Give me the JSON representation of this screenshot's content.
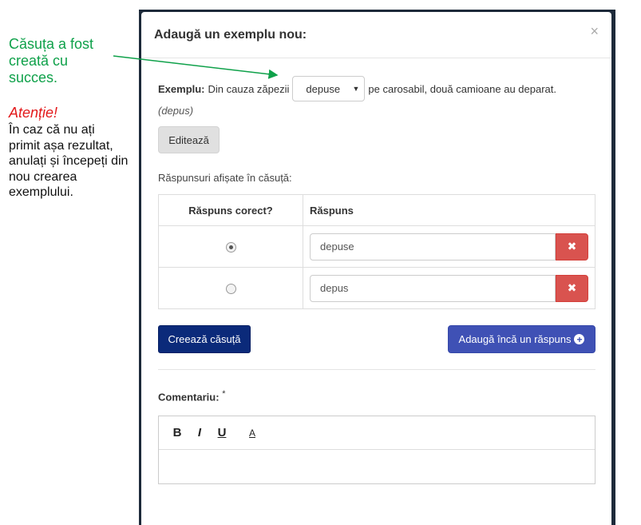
{
  "annotation": {
    "success": "Căsuța a fost creată cu succes.",
    "warning_title": "Atenție!",
    "warning_body": "În caz că nu ați primit așa rezultat, anulați și începeți din nou crearea exemplului."
  },
  "modal": {
    "title": "Adaugă un exemplu nou:",
    "close": "×",
    "example": {
      "label": "Exemplu:",
      "before": "Din cauza zăpezii",
      "dropdown_value": "depuse",
      "after": "pe carosabil, două camioane au deparat.",
      "hint": "(depus)"
    },
    "edit_button": "Editează",
    "answers_label": "Răspunsuri afișate în căsuță:",
    "table": {
      "col_correct": "Răspuns corect?",
      "col_answer": "Răspuns",
      "rows": [
        {
          "value": "depuse",
          "correct": true
        },
        {
          "value": "depus",
          "correct": false
        }
      ]
    },
    "create_button": "Creează căsuță",
    "add_button": "Adaugă încă un răspuns",
    "comment_label": "Comentariu:",
    "comment_required": "*",
    "toolbar": {
      "bold": "B",
      "italic": "I",
      "underline": "U",
      "color": "A"
    }
  },
  "colors": {
    "annotation_green": "#0fa14a",
    "warning_red": "#e3191b",
    "primary_dark": "#0b2a7a",
    "primary": "#3f51b5",
    "danger": "#d9534f"
  }
}
